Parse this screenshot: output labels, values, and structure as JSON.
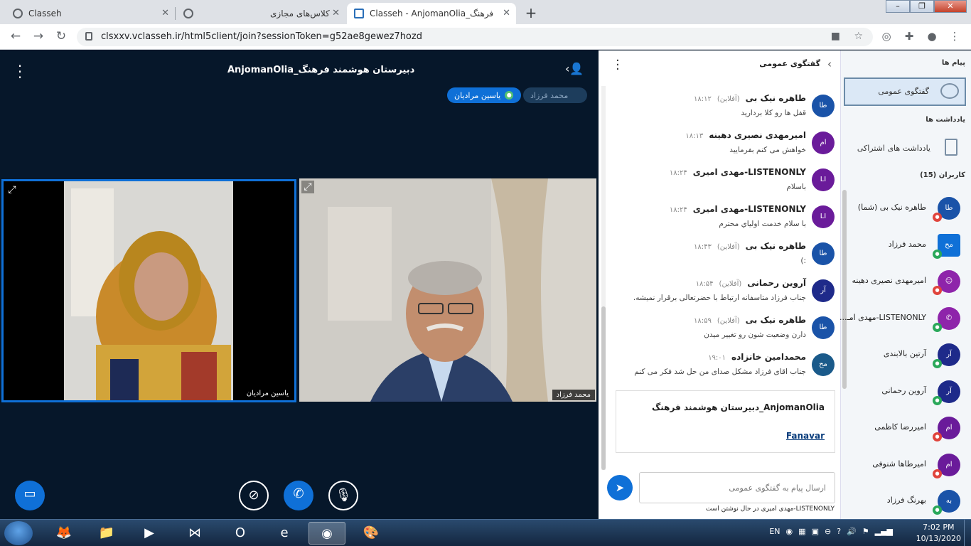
{
  "browser": {
    "tabs": [
      {
        "title": "Classeh"
      },
      {
        "title": "کلاس‌های مجازی"
      },
      {
        "title": "Classeh - AnjomanOlia_فرهنگ"
      }
    ],
    "url": "clsxxv.vclasseh.ir/html5client/join?sessionToken=g52ae8gewez7hozd"
  },
  "meeting": {
    "title": "AnjomanOlia_دبیرستان هوشمند فرهنگ",
    "talkers": [
      "یاسین مرادیان",
      "محمد فرزاد"
    ],
    "videos": [
      {
        "label": "یاسین مرادیان"
      },
      {
        "label": "محمد فرزاد"
      }
    ]
  },
  "chat": {
    "title": "گفتگوی عمومی",
    "messages": [
      {
        "initials": "طا",
        "name": "طاهره نیک بی",
        "status": "(آفلاین)",
        "time": "۱۸:۱۲",
        "text": "قفل ها رو کلا بردارید",
        "color": "#1a53a8"
      },
      {
        "initials": "ام",
        "name": "امیرمهدی نصیری دهینه",
        "status": "",
        "time": "۱۸:۱۳",
        "text": "خواهش می کنم بفرمایید",
        "color": "#6a1b9a"
      },
      {
        "initials": "LI",
        "name": "LISTENONLY-مهدی امیری",
        "status": "",
        "time": "۱۸:۲۴",
        "text": "باسلام",
        "color": "#6a1b9a"
      },
      {
        "initials": "LI",
        "name": "LISTENONLY-مهدی امیری",
        "status": "",
        "time": "۱۸:۲۴",
        "text": "با سلام خدمت اولیاي محترم",
        "color": "#6a1b9a"
      },
      {
        "initials": "طا",
        "name": "طاهره نیک بی",
        "status": "(آفلاین)",
        "time": "۱۸:۴۳",
        "text": ":)",
        "color": "#1a53a8"
      },
      {
        "initials": "آر",
        "name": "آروین رحمانی",
        "status": "(آفلاین)",
        "time": "۱۸:۵۴",
        "text": "جناب فرزاد متاسفانه ارتباط با حضرتعالی برقرار نمیشه.",
        "color": "#1e2a8a"
      },
      {
        "initials": "طا",
        "name": "طاهره نیک بی",
        "status": "(آفلاین)",
        "time": "۱۸:۵۹",
        "text": "دارن وضعیت شون رو تغییر میدن",
        "color": "#1a53a8"
      },
      {
        "initials": "مح",
        "name": "محمدامین خانزاده",
        "status": "",
        "time": "۱۹:۰۱",
        "text": "جناب اقای فرزاد مشکل صدای من حل شد فکر می کنم",
        "color": "#1a5a8a"
      }
    ],
    "welcome_line1": "AnjomanOlia_دبیرستان هوشمند فرهنگ",
    "welcome_line2": "Fanavar",
    "input_placeholder": "ارسال پیام به گفتگوی عمومی",
    "typing": "LISTENONLY-مهدی امیری در حال نوشتن است"
  },
  "userlist": {
    "messages_heading": "پیام ها",
    "public_chat": "گفتگوی عمومی",
    "notes_heading": "یادداشت ها",
    "shared_notes": "یادداشت های اشتراکی",
    "users_heading": "کاربران (15)",
    "users": [
      {
        "initials": "طا",
        "name": "طاهره نیک بی (شما)",
        "color": "#1a53a8",
        "status_color": "#e0443c"
      },
      {
        "initials": "مح",
        "name": "محمد فرزاد",
        "color": "#0f70d7",
        "status_color": "#2aa85a"
      },
      {
        "initials": "☺",
        "name": "امیرمهدی نصیری دهینه",
        "color": "#8e24aa",
        "status_color": "#e0443c"
      },
      {
        "initials": "✆",
        "name": "LISTENONLY-مهدی امـ...",
        "color": "#8e24aa",
        "status_color": "#2aa85a"
      },
      {
        "initials": "آر",
        "name": "آرتین بالابندی",
        "color": "#1e2a8a",
        "status_color": "#2aa85a"
      },
      {
        "initials": "آر",
        "name": "آروین رحمانی",
        "color": "#1e2a8a",
        "status_color": "#2aa85a"
      },
      {
        "initials": "ام",
        "name": "امیررضا کاظمی",
        "color": "#6a1b9a",
        "status_color": "#e0443c"
      },
      {
        "initials": "ام",
        "name": "امیرطاها شنوفی",
        "color": "#6a1b9a",
        "status_color": "#e0443c"
      },
      {
        "initials": "به",
        "name": "بهرنگ فرزاد",
        "color": "#1a53a8",
        "status_color": "#2aa85a"
      }
    ]
  },
  "taskbar": {
    "lang": "EN",
    "time": "7:02 PM",
    "date": "10/13/2020"
  }
}
